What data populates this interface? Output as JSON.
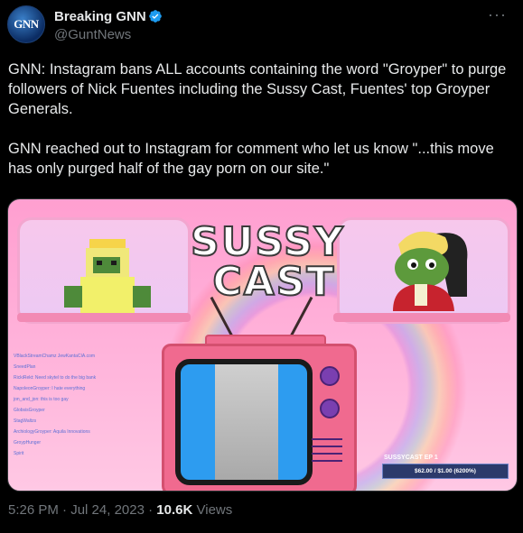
{
  "author": {
    "display_name": "Breaking GNN",
    "handle": "@GuntNews",
    "avatar_text": "GNN"
  },
  "tweet": {
    "paragraph1": "GNN: Instagram bans ALL accounts containing the word \"Groyper\" to purge followers of Nick Fuentes including the Sussy Cast, Fuentes' top Groyper Generals.",
    "paragraph2": "GNN reached out to Instagram for comment who let us know \"...this move has only purged half of the gay porn on our site.\""
  },
  "media": {
    "logo_line1": "SUSSY",
    "logo_line2": "CAST",
    "episode_label": "SUSSYCAST EP 1",
    "episode_price": "$62.00 / $1.00 (6200%)",
    "chat_lines": [
      "VBlackStreamChamz JewKantaCIA.com",
      "SneedPlan",
      "RickiRekt: Need skytel to do the big bank",
      "NapoleonGroyper: I hate everything",
      "jon_and_jon: this is too gay",
      "GlobsisGroyper",
      "StagWaltzs",
      "ArchiologyGroyper: Aquila Innovations",
      "GroypHunger",
      "Spirit"
    ]
  },
  "footer": {
    "time": "5:26 PM",
    "separator": "·",
    "date": "Jul 24, 2023",
    "views_count": "10.6K",
    "views_label": "Views"
  },
  "colors": {
    "verified_blue": "#1d9bf0",
    "muted": "#71767b"
  },
  "icons": [
    "verified-badge-icon",
    "more-options-icon"
  ]
}
